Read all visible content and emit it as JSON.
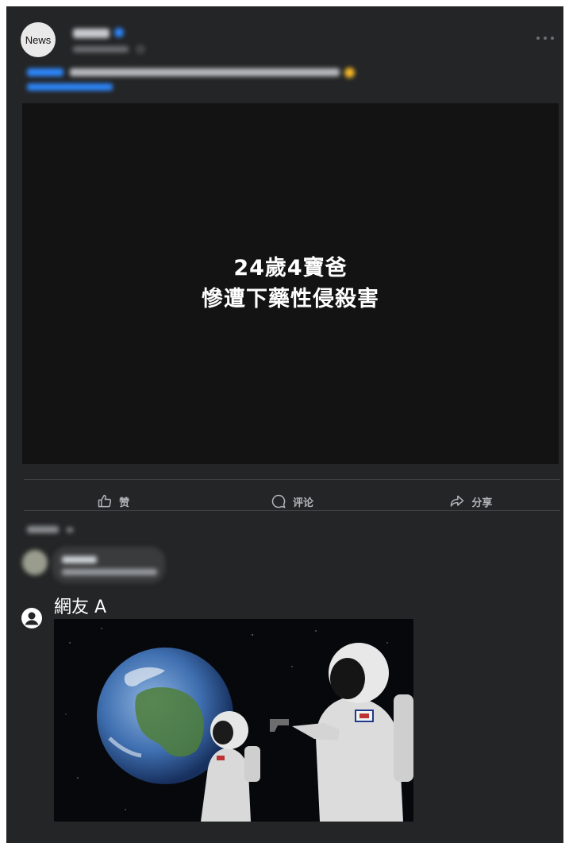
{
  "post": {
    "avatar_label": "News",
    "video_title_lines": [
      "24歲4寶爸",
      "慘遭下藥性侵殺害"
    ]
  },
  "actions": {
    "like_label": "赞",
    "comment_label": "评论",
    "share_label": "分享"
  },
  "comment": {
    "username": "網友 A",
    "image_icon": "astronauts-earth-meme"
  },
  "colors": {
    "background": "#242526",
    "video_background": "#131314",
    "accent_link": "#2d88ff",
    "action_text": "#b0b3b8"
  }
}
